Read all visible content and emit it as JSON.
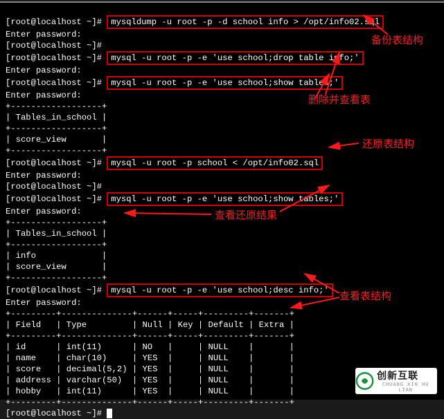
{
  "prompt": "[root@localhost ~]# ",
  "enterpw": "Enter password: ",
  "cmd": {
    "dump": "mysqldump -u root -p -d school info > /opt/info02.sql",
    "drop": "mysql -u root -p -e 'use school;drop table info;'",
    "show1": "mysql -u root -p -e 'use school;show tables;'",
    "restore": "mysql -u root -p school < /opt/info02.sql",
    "show2": "mysql -u root -p -e 'use school;show tables;'",
    "desc": "mysql -u root -p -e 'use school;desc info;'"
  },
  "table1": {
    "sep": "+------------------+",
    "head": "| Tables_in_school |",
    "rows": [
      "| score_view       |"
    ]
  },
  "table2": {
    "sep": "+------------------+",
    "head": "| Tables_in_school |",
    "rows": [
      "| info             |",
      "| score_view       |"
    ]
  },
  "desc": {
    "sep": "+---------+--------------+------+-----+---------+-------+",
    "head": "| Field   | Type         | Null | Key | Default | Extra |",
    "rows": [
      "| id      | int(11)      | NO   |     | NULL    |       |",
      "| name    | char(10)     | YES  |     | NULL    |       |",
      "| score   | decimal(5,2) | YES  |     | NULL    |       |",
      "| address | varchar(50)  | YES  |     | NULL    |       |",
      "| hobby   | int(11)      | YES  |     | NULL    |       |"
    ]
  },
  "annotations": {
    "a1": "备份表结构",
    "a2": "删除并查看表",
    "a3": "还原表结构",
    "a4": "查看还原结果",
    "a5": "查看表结构"
  },
  "logo": {
    "name": "创新互联",
    "sub": "CHUANG XIN HU LIAN"
  }
}
